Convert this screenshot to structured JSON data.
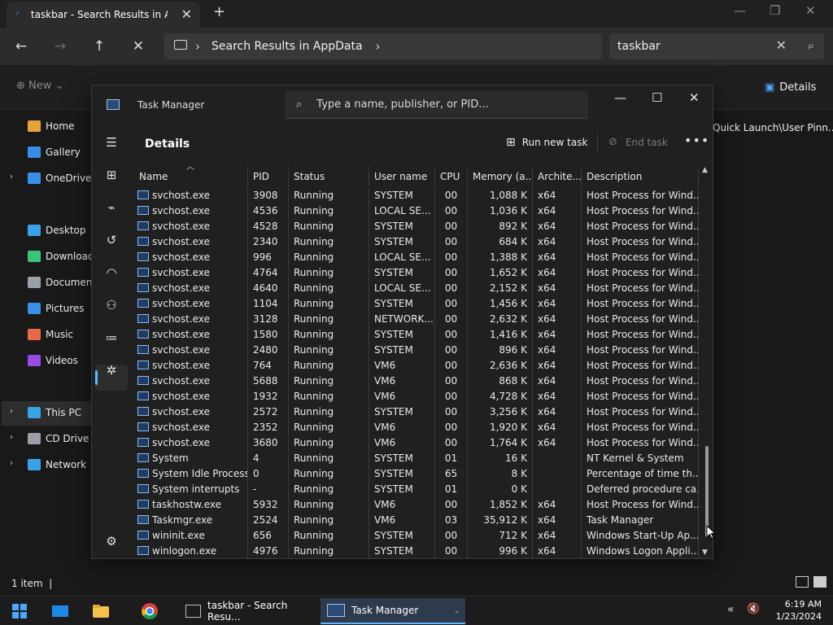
{
  "explorer": {
    "tab_title": "taskbar - Search Results in AppData",
    "address": "Search Results in AppData",
    "search_value": "taskbar",
    "cmd_new": "New",
    "cmd_details": "Details",
    "right_path": "Quick Launch\\User Pinn...",
    "status_count": "1 item",
    "sidebar": [
      {
        "label": "Home",
        "icon": "home-icon",
        "color": "#e8a33a"
      },
      {
        "label": "Gallery",
        "icon": "gallery-icon",
        "color": "#3a8ee8"
      },
      {
        "label": "OneDrive",
        "icon": "cloud-icon",
        "color": "#3a8ee8"
      },
      {
        "label": "Desktop",
        "icon": "desktop-icon",
        "color": "#3aa0e8"
      },
      {
        "label": "Downloads",
        "icon": "download-icon",
        "color": "#3ac47a"
      },
      {
        "label": "Documents",
        "icon": "document-icon",
        "color": "#9aa0a8"
      },
      {
        "label": "Pictures",
        "icon": "pictures-icon",
        "color": "#3a8ee8"
      },
      {
        "label": "Music",
        "icon": "music-icon",
        "color": "#e86a4a"
      },
      {
        "label": "Videos",
        "icon": "videos-icon",
        "color": "#9a4ae8"
      },
      {
        "label": "This PC",
        "icon": "pc-icon",
        "color": "#3aa0e8"
      },
      {
        "label": "CD Drive (D:)",
        "icon": "cd-icon",
        "color": "#9aa0a8"
      },
      {
        "label": "Network",
        "icon": "network-icon",
        "color": "#3aa0e8"
      }
    ]
  },
  "taskmgr": {
    "title": "Task Manager",
    "search_placeholder": "Type a name, publisher, or PID...",
    "heading": "Details",
    "run_new_task": "Run new task",
    "end_task": "End task",
    "columns": [
      "Name",
      "PID",
      "Status",
      "User name",
      "CPU",
      "Memory (a...",
      "Archite...",
      "Description"
    ],
    "rows": [
      [
        "svchost.exe",
        "3908",
        "Running",
        "SYSTEM",
        "00",
        "1,088 K",
        "x64",
        "Host Process for Wind..."
      ],
      [
        "svchost.exe",
        "4536",
        "Running",
        "LOCAL SE...",
        "00",
        "1,036 K",
        "x64",
        "Host Process for Wind..."
      ],
      [
        "svchost.exe",
        "4528",
        "Running",
        "SYSTEM",
        "00",
        "892 K",
        "x64",
        "Host Process for Wind..."
      ],
      [
        "svchost.exe",
        "2340",
        "Running",
        "SYSTEM",
        "00",
        "684 K",
        "x64",
        "Host Process for Wind..."
      ],
      [
        "svchost.exe",
        "996",
        "Running",
        "LOCAL SE...",
        "00",
        "1,388 K",
        "x64",
        "Host Process for Wind..."
      ],
      [
        "svchost.exe",
        "4764",
        "Running",
        "SYSTEM",
        "00",
        "1,652 K",
        "x64",
        "Host Process for Wind..."
      ],
      [
        "svchost.exe",
        "4640",
        "Running",
        "LOCAL SE...",
        "00",
        "2,152 K",
        "x64",
        "Host Process for Wind..."
      ],
      [
        "svchost.exe",
        "1104",
        "Running",
        "SYSTEM",
        "00",
        "1,456 K",
        "x64",
        "Host Process for Wind..."
      ],
      [
        "svchost.exe",
        "3128",
        "Running",
        "NETWORK...",
        "00",
        "2,632 K",
        "x64",
        "Host Process for Wind..."
      ],
      [
        "svchost.exe",
        "1580",
        "Running",
        "SYSTEM",
        "00",
        "1,416 K",
        "x64",
        "Host Process for Wind..."
      ],
      [
        "svchost.exe",
        "2480",
        "Running",
        "SYSTEM",
        "00",
        "896 K",
        "x64",
        "Host Process for Wind..."
      ],
      [
        "svchost.exe",
        "764",
        "Running",
        "VM6",
        "00",
        "2,636 K",
        "x64",
        "Host Process for Wind..."
      ],
      [
        "svchost.exe",
        "5688",
        "Running",
        "VM6",
        "00",
        "868 K",
        "x64",
        "Host Process for Wind..."
      ],
      [
        "svchost.exe",
        "1932",
        "Running",
        "VM6",
        "00",
        "4,728 K",
        "x64",
        "Host Process for Wind..."
      ],
      [
        "svchost.exe",
        "2572",
        "Running",
        "SYSTEM",
        "00",
        "3,256 K",
        "x64",
        "Host Process for Wind..."
      ],
      [
        "svchost.exe",
        "2352",
        "Running",
        "VM6",
        "00",
        "1,920 K",
        "x64",
        "Host Process for Wind..."
      ],
      [
        "svchost.exe",
        "3680",
        "Running",
        "VM6",
        "00",
        "1,764 K",
        "x64",
        "Host Process for Wind..."
      ],
      [
        "System",
        "4",
        "Running",
        "SYSTEM",
        "01",
        "16 K",
        "",
        "NT Kernel & System"
      ],
      [
        "System Idle Process",
        "0",
        "Running",
        "SYSTEM",
        "65",
        "8 K",
        "",
        "Percentage of time th..."
      ],
      [
        "System interrupts",
        "-",
        "Running",
        "SYSTEM",
        "01",
        "0 K",
        "",
        "Deferred procedure ca..."
      ],
      [
        "taskhostw.exe",
        "5932",
        "Running",
        "VM6",
        "00",
        "1,852 K",
        "x64",
        "Host Process for Wind..."
      ],
      [
        "Taskmgr.exe",
        "2524",
        "Running",
        "VM6",
        "03",
        "35,912 K",
        "x64",
        "Task Manager"
      ],
      [
        "wininit.exe",
        "656",
        "Running",
        "SYSTEM",
        "00",
        "712 K",
        "x64",
        "Windows Start-Up Ap..."
      ],
      [
        "winlogon.exe",
        "4976",
        "Running",
        "SYSTEM",
        "00",
        "996 K",
        "x64",
        "Windows Logon Appli..."
      ]
    ]
  },
  "taskbar": {
    "explorer_label": "taskbar - Search Resu...",
    "taskmgr_label": "Task Manager",
    "time": "6:19 AM",
    "date": "1/23/2024"
  },
  "colors": {
    "accent": "#4cc2ff",
    "bg": "#202020"
  }
}
